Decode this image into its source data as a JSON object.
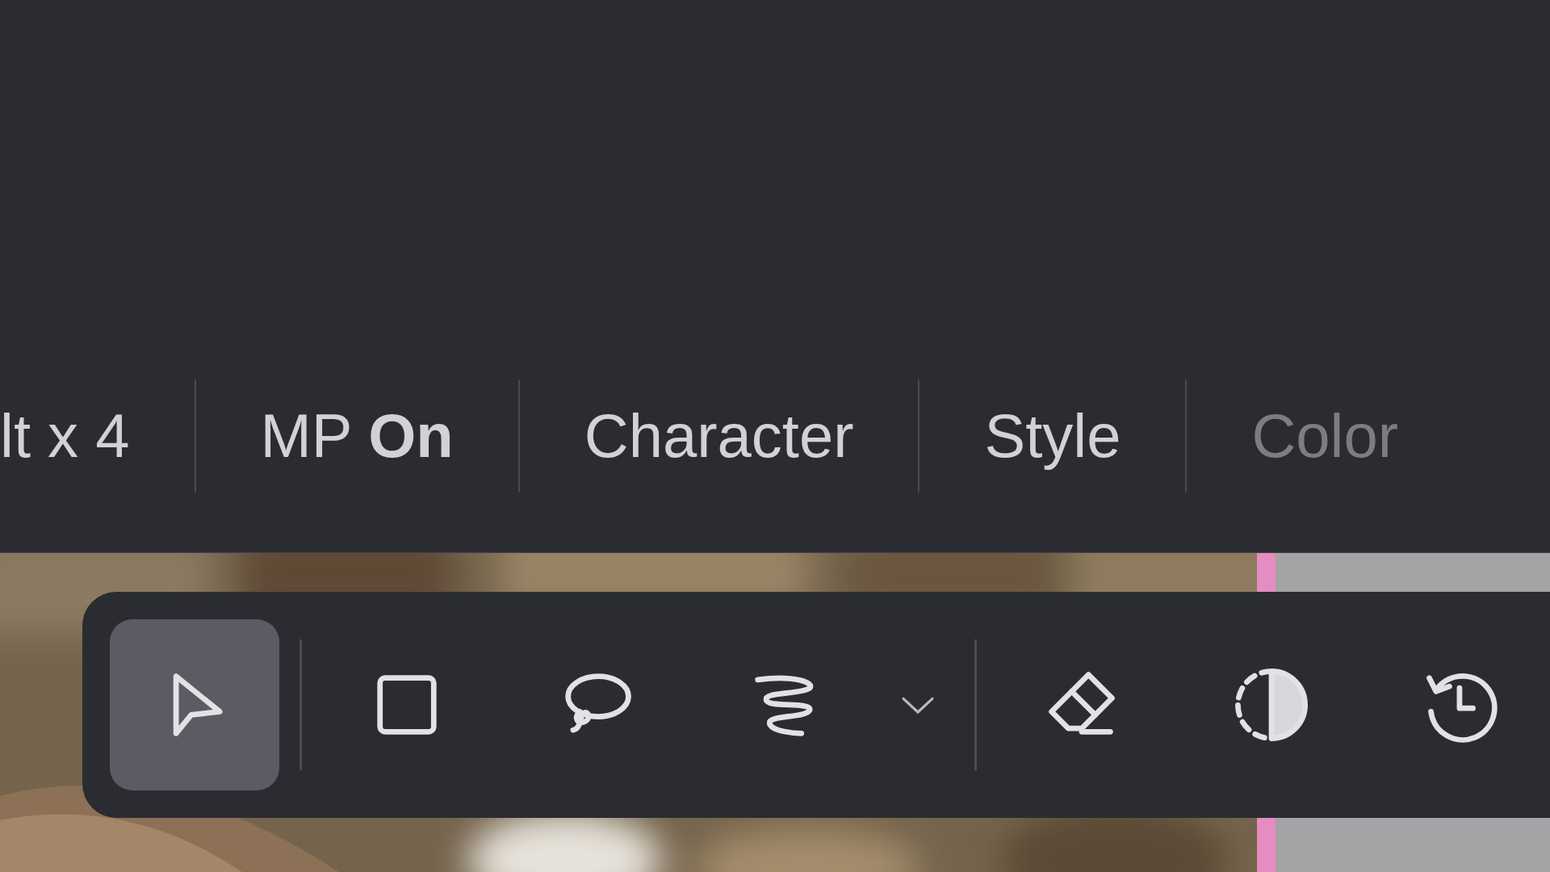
{
  "tabs": [
    {
      "label": "lt x 4",
      "disabled": false
    },
    {
      "label": "MP **On**",
      "disabled": false
    },
    {
      "label": "Character",
      "disabled": false
    },
    {
      "label": "Style",
      "disabled": false
    },
    {
      "label": "Color",
      "disabled": true
    }
  ],
  "toolbar": {
    "groups": [
      [
        {
          "kind": "pointer",
          "selected": true
        }
      ],
      [
        {
          "kind": "rectangle",
          "selected": false
        },
        {
          "kind": "lasso",
          "selected": false
        },
        {
          "kind": "brush",
          "selected": false
        },
        {
          "kind": "dropdown",
          "selected": false
        }
      ],
      [
        {
          "kind": "eraser",
          "selected": false
        },
        {
          "kind": "contrast",
          "selected": false
        },
        {
          "kind": "history",
          "selected": false
        }
      ]
    ]
  }
}
